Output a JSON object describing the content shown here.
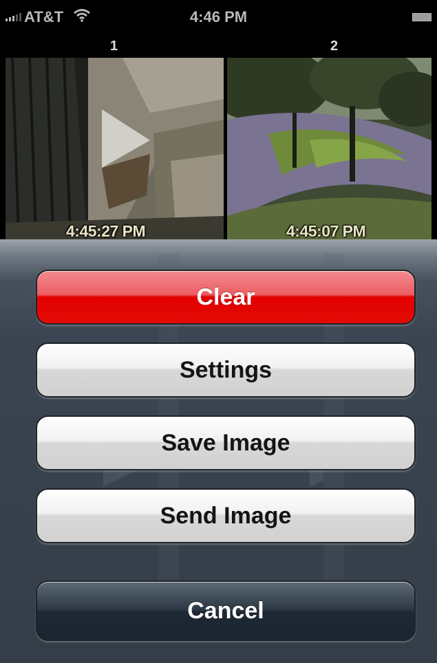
{
  "status_bar": {
    "carrier": "AT&T",
    "time": "4:46 PM",
    "signal_icon": "signal-bars-icon",
    "wifi_icon": "wifi-icon",
    "battery_icon": "battery-icon"
  },
  "cameras": [
    {
      "number": "1",
      "timestamp": "4:45:27 PM"
    },
    {
      "number": "2",
      "timestamp": "4:45:07 PM"
    }
  ],
  "action_sheet": {
    "clear_label": "Clear",
    "settings_label": "Settings",
    "save_image_label": "Save Image",
    "send_image_label": "Send Image",
    "cancel_label": "Cancel"
  },
  "colors": {
    "destructive": "#e20000",
    "sheet_background": "#3b4551",
    "cancel_button": "#1e2834"
  }
}
